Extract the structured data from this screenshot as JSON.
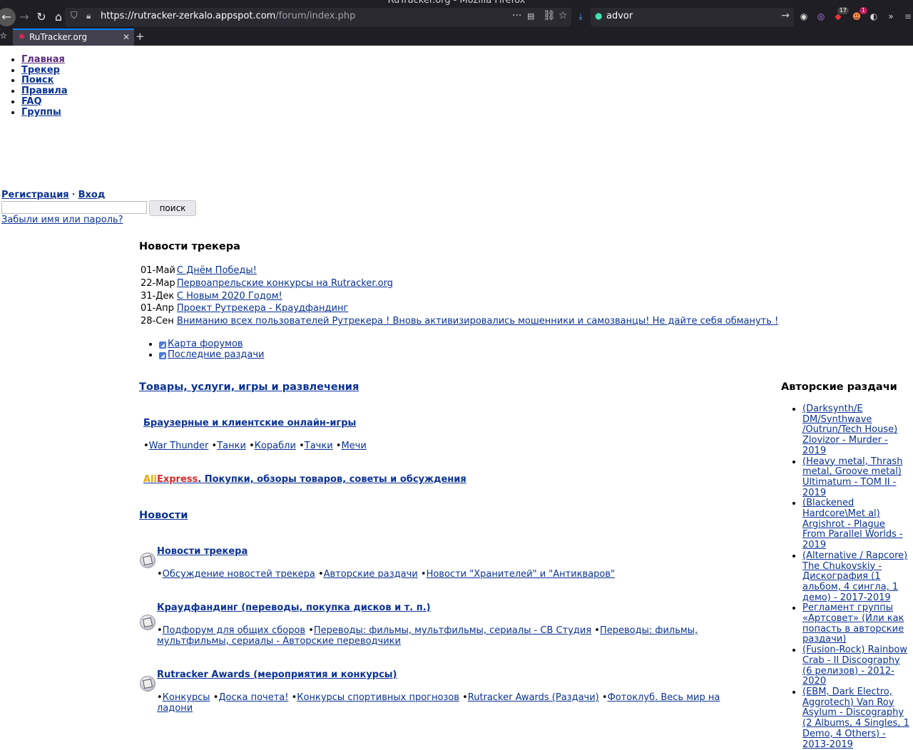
{
  "browser": {
    "window_title": "RuTracker.org - Mozilla Firefox",
    "url_host": "https://rutracker-zerkalo.appspot.com",
    "url_path": "/forum/index.php",
    "search_value": "advor",
    "tab_title": "RuTracker.org",
    "ext_badge_1": "17",
    "ext_badge_2": "1"
  },
  "topnav": [
    "Главная",
    "Трекер",
    "Поиск",
    "Правила",
    "FAQ",
    "Группы"
  ],
  "login": {
    "register": "Регистрация",
    "separator": "·",
    "login": "Вход",
    "search_button": "поиск",
    "forgot": "Забыли имя или пароль?"
  },
  "news": {
    "heading": "Новости трекера",
    "items": [
      {
        "date": "01-Май",
        "text": "С Днём Победы!"
      },
      {
        "date": "22-Мар",
        "text": "Первоапрельские конкурсы на Rutracker.org"
      },
      {
        "date": "31-Дек",
        "text": "С Новым 2020 Годом!"
      },
      {
        "date": "01-Апр",
        "text": "Проект Рутрекера - Краудфандинг"
      },
      {
        "date": "28-Сен",
        "text": "Вниманию всех пользователей Рутрекера ! Вновь активизировались мошенники и самозванцы! Не дайте себя обмануть !"
      }
    ],
    "feeds": [
      "Карта форумов",
      "Последние раздачи"
    ]
  },
  "categories": {
    "goods": {
      "title": "Товары, услуги, игры и развлечения",
      "browser_games": "Браузерные и клиентские онлайн-игры",
      "games": [
        "War Thunder",
        "Танки",
        "Корабли",
        "Тачки",
        "Мечи"
      ],
      "ali_prefix": "Ali",
      "ali_express": "Express",
      "ali_rest": ". Покупки, обзоры товаров, советы и обсуждения"
    },
    "news": {
      "title": "Новости",
      "forums": [
        {
          "title": "Новости трекера",
          "subs": [
            "Обсуждение новостей трекера",
            "Авторские раздачи",
            "Новости \"Хранителей\" и \"Антикваров\""
          ]
        },
        {
          "title": "Краудфандинг (переводы, покупка дисков и т. п.)",
          "subs": [
            "Подфорум для общих сборов",
            "Переводы: фильмы, мультфильмы, сериалы - CB Студия",
            "Переводы: фильмы, мультфильмы, сериалы - Авторские переводчики"
          ]
        },
        {
          "title": "Rutracker Awards (мероприятия и конкурсы)",
          "subs": [
            "Конкурсы",
            "Доска почета!",
            "Конкурсы спортивных прогнозов",
            "Rutracker Awards (Раздачи)",
            "Фотоклуб. Весь мир на ладони"
          ]
        }
      ]
    }
  },
  "sidebar": {
    "heading": "Авторские раздачи",
    "items": [
      "(Darksynth/E DM/Synthwave /Outrun/Tech House) Zlovizor - Murder - 2019",
      "(Heavy metal, Thrash metal, Groove metal) Ultimatum - TOM II - 2019",
      "(Blackened Hardcore\\Met al) Argishrot - Plague From Parallel Worlds - 2019",
      "(Alternative / Rapcore) The Chukovskiy - Дискография (1 альбом, 4 сингла, 1 демо) - 2017-2019",
      "Регламент группы «Артсовет» (Или как попасть в авторские раздачи)",
      "(Fusion-Rock) Rainbow Crab - II Discography (6 релизов) - 2012-2020",
      "(EBM, Dark Electro, Aggrotech) Van Roy Asylum - Discography (2 Albums, 4 Singles, 1 Demo, 4 Others) - 2013-2019"
    ]
  }
}
